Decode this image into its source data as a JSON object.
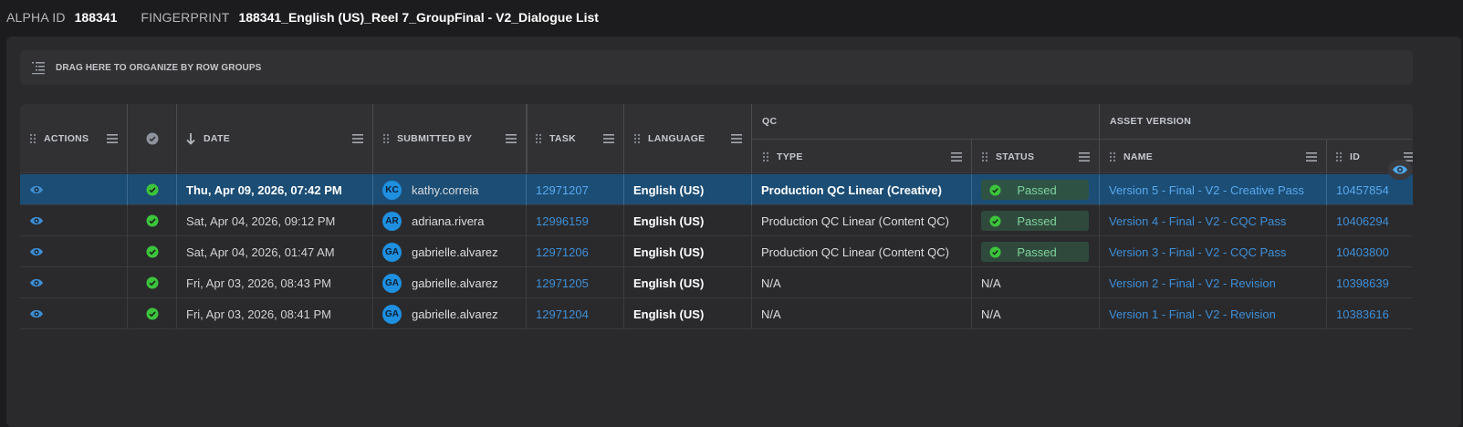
{
  "header": {
    "alpha_id_label": "ALPHA ID",
    "alpha_id_value": "188341",
    "fingerprint_label": "FINGERPRINT",
    "fingerprint_value": "188341_English (US)_Reel 7_GroupFinal - V2_Dialogue List"
  },
  "group_bar": {
    "text": "DRAG HERE TO ORGANIZE BY ROW GROUPS",
    "icon": "row-groups-icon"
  },
  "columns": {
    "actions": "ACTIONS",
    "check": "check-circle-icon",
    "date": "DATE",
    "submitted_by": "SUBMITTED BY",
    "task": "TASK",
    "language": "LANGUAGE",
    "qc_group": "QC",
    "type": "TYPE",
    "status": "STATUS",
    "asset_group": "ASSET VERSION",
    "name": "NAME",
    "id": "ID"
  },
  "rows": [
    {
      "date": "Thu, Apr 09, 2026, 07:42 PM",
      "initials": "KC",
      "user": "kathy.correia",
      "task": "12971207",
      "language": "English (US)",
      "type": "Production QC Linear (Creative)",
      "status": "Passed",
      "name": "Version 5 - Final - V2 - Creative Pass",
      "id": "10457854",
      "selected": true
    },
    {
      "date": "Sat, Apr 04, 2026, 09:12 PM",
      "initials": "AR",
      "user": "adriana.rivera",
      "task": "12996159",
      "language": "English (US)",
      "type": "Production QC Linear (Content QC)",
      "status": "Passed",
      "name": "Version 4 - Final - V2 - CQC Pass",
      "id": "10406294",
      "selected": false
    },
    {
      "date": "Sat, Apr 04, 2026, 01:47 AM",
      "initials": "GA",
      "user": "gabrielle.alvarez",
      "task": "12971206",
      "language": "English (US)",
      "type": "Production QC Linear (Content QC)",
      "status": "Passed",
      "name": "Version 3 - Final - V2 - CQC Pass",
      "id": "10403800",
      "selected": false
    },
    {
      "date": "Fri, Apr 03, 2026, 08:43 PM",
      "initials": "GA",
      "user": "gabrielle.alvarez",
      "task": "12971205",
      "language": "English (US)",
      "type": "N/A",
      "status": "N/A",
      "name": "Version 2 - Final - V2 - Revision",
      "id": "10398639",
      "selected": false
    },
    {
      "date": "Fri, Apr 03, 2026, 08:41 PM",
      "initials": "GA",
      "user": "gabrielle.alvarez",
      "task": "12971204",
      "language": "English (US)",
      "type": "N/A",
      "status": "N/A",
      "name": "Version 1 - Final - V2 - Revision",
      "id": "10383616",
      "selected": false
    }
  ],
  "icons": {
    "row_action": "eye-icon",
    "row_check": "check-circle-icon",
    "status": "check-circle-icon",
    "floating": "eye-icon"
  },
  "colors": {
    "accent_link": "#3e8fd6",
    "selected_row": "#1b4d75",
    "passed_text": "#7fd39d",
    "check_green": "#3cc43c",
    "avatar": "#1f8fe0"
  }
}
